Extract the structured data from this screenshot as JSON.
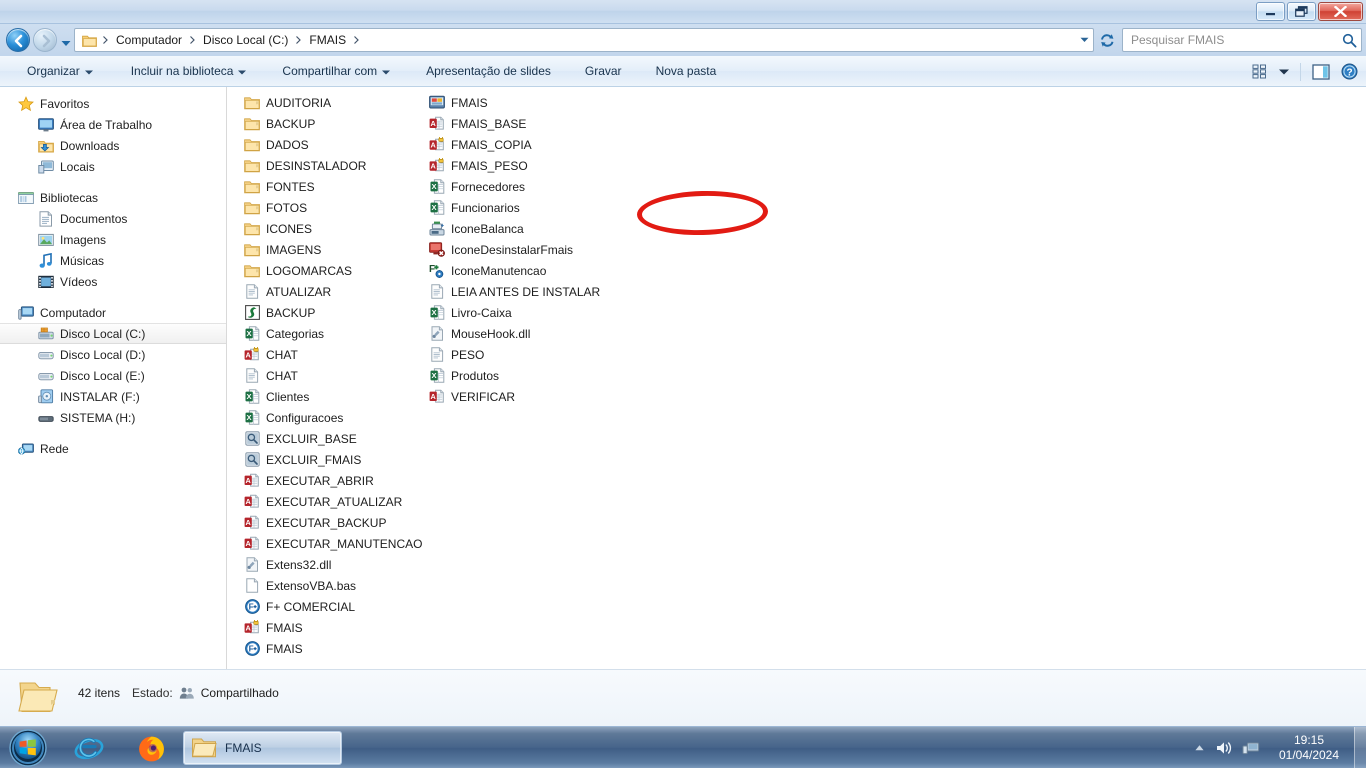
{
  "window": {
    "controls": {
      "minimize": "Minimizar",
      "maximize": "Maximizar",
      "close": "Fechar"
    }
  },
  "address": {
    "crumbs": [
      "Computador",
      "Disco Local (C:)",
      "FMAIS"
    ],
    "dropdown": "Histórico de locais",
    "refresh": "Atualizar"
  },
  "search": {
    "placeholder": "Pesquisar FMAIS",
    "value": ""
  },
  "toolbar": {
    "items": [
      {
        "label": "Organizar",
        "caret": true
      },
      {
        "label": "Incluir na biblioteca",
        "caret": true
      },
      {
        "label": "Compartilhar com",
        "caret": true
      },
      {
        "label": "Apresentação de slides",
        "caret": false
      },
      {
        "label": "Gravar",
        "caret": false
      },
      {
        "label": "Nova pasta",
        "caret": false
      }
    ],
    "view_label": "Alterar a exibição",
    "preview_label": "Mostrar o painel de visualização",
    "help_label": "Obter ajuda"
  },
  "sidebar": {
    "groups": [
      {
        "header": {
          "label": "Favoritos",
          "icon": "star-icon"
        },
        "items": [
          {
            "label": "Área de Trabalho",
            "icon": "desktop-icon"
          },
          {
            "label": "Downloads",
            "icon": "downloads-icon"
          },
          {
            "label": "Locais",
            "icon": "places-icon"
          }
        ]
      },
      {
        "header": {
          "label": "Bibliotecas",
          "icon": "libraries-icon"
        },
        "items": [
          {
            "label": "Documentos",
            "icon": "documents-icon"
          },
          {
            "label": "Imagens",
            "icon": "pictures-icon"
          },
          {
            "label": "Músicas",
            "icon": "music-icon"
          },
          {
            "label": "Vídeos",
            "icon": "videos-icon"
          }
        ]
      },
      {
        "header": {
          "label": "Computador",
          "icon": "computer-icon"
        },
        "items": [
          {
            "label": "Disco Local (C:)",
            "icon": "system-drive-icon",
            "selected": true
          },
          {
            "label": "Disco Local (D:)",
            "icon": "drive-icon"
          },
          {
            "label": "Disco Local (E:)",
            "icon": "drive-icon"
          },
          {
            "label": "INSTALAR (F:)",
            "icon": "cd-drive-icon"
          },
          {
            "label": "SISTEMA (H:)",
            "icon": "usb-drive-icon"
          }
        ]
      },
      {
        "header": {
          "label": "Rede",
          "icon": "network-icon"
        },
        "items": []
      }
    ]
  },
  "files": {
    "columns": [
      {
        "items": [
          {
            "name": "AUDITORIA",
            "icon": "folder-icon"
          },
          {
            "name": "BACKUP",
            "icon": "folder-icon"
          },
          {
            "name": "DADOS",
            "icon": "folder-icon"
          },
          {
            "name": "DESINSTALADOR",
            "icon": "folder-icon"
          },
          {
            "name": "FONTES",
            "icon": "folder-icon"
          },
          {
            "name": "FOTOS",
            "icon": "folder-icon"
          },
          {
            "name": "ICONES",
            "icon": "folder-icon"
          },
          {
            "name": "IMAGENS",
            "icon": "folder-icon"
          },
          {
            "name": "LOGOMARCAS",
            "icon": "folder-icon"
          },
          {
            "name": "ATUALIZAR",
            "icon": "text-file-icon"
          },
          {
            "name": "BACKUP",
            "icon": "script-icon"
          },
          {
            "name": "Categorias",
            "icon": "excel-icon"
          },
          {
            "name": "CHAT",
            "icon": "access-locked-icon"
          },
          {
            "name": "CHAT",
            "icon": "text-file-icon"
          },
          {
            "name": "Clientes",
            "icon": "excel-icon"
          },
          {
            "name": "Configuracoes",
            "icon": "excel-icon"
          },
          {
            "name": "EXCLUIR_BASE",
            "icon": "batch-icon"
          },
          {
            "name": "EXCLUIR_FMAIS",
            "icon": "batch-icon"
          },
          {
            "name": "EXECUTAR_ABRIR",
            "icon": "access-shortcut-icon"
          },
          {
            "name": "EXECUTAR_ATUALIZAR",
            "icon": "access-shortcut-icon"
          },
          {
            "name": "EXECUTAR_BACKUP",
            "icon": "access-shortcut-icon"
          },
          {
            "name": "EXECUTAR_MANUTENCAO",
            "icon": "access-shortcut-icon"
          },
          {
            "name": "Extens32.dll",
            "icon": "dll-icon"
          },
          {
            "name": "ExtensoVBA.bas",
            "icon": "blank-file-icon"
          },
          {
            "name": "F+ COMERCIAL",
            "icon": "fplus-icon"
          },
          {
            "name": "FMAIS",
            "icon": "access-locked-icon"
          },
          {
            "name": "FMAIS",
            "icon": "fplus-icon"
          }
        ]
      },
      {
        "items": [
          {
            "name": "FMAIS",
            "icon": "app-icon"
          },
          {
            "name": "FMAIS_BASE",
            "icon": "access-shortcut-icon",
            "annotated": true
          },
          {
            "name": "FMAIS_COPIA",
            "icon": "access-locked-icon"
          },
          {
            "name": "FMAIS_PESO",
            "icon": "access-locked-icon"
          },
          {
            "name": "Fornecedores",
            "icon": "excel-icon"
          },
          {
            "name": "Funcionarios",
            "icon": "excel-icon"
          },
          {
            "name": "IconeBalanca",
            "icon": "balance-icon"
          },
          {
            "name": "IconeDesinstalarFmais",
            "icon": "uninstall-icon"
          },
          {
            "name": "IconeManutencao",
            "icon": "maintenance-icon"
          },
          {
            "name": "LEIA ANTES DE INSTALAR",
            "icon": "text-file-icon"
          },
          {
            "name": "Livro-Caixa",
            "icon": "excel-icon"
          },
          {
            "name": "MouseHook.dll",
            "icon": "dll-icon"
          },
          {
            "name": "PESO",
            "icon": "text-file-icon"
          },
          {
            "name": "Produtos",
            "icon": "excel-icon"
          },
          {
            "name": "VERIFICAR",
            "icon": "access-shortcut-icon"
          }
        ]
      }
    ]
  },
  "status": {
    "count": "42 itens",
    "state_label": "Estado:",
    "state_value": "Compartilhado",
    "folder_icon": "folder-large-icon",
    "shared_icon": "shared-users-icon"
  },
  "taskbar": {
    "start_label": "Iniciar",
    "quicklaunch": [
      {
        "label": "Internet Explorer",
        "icon": "ie-icon"
      },
      {
        "label": "Mozilla Firefox",
        "icon": "firefox-icon"
      }
    ],
    "buttons": [
      {
        "label": "FMAIS",
        "icon": "folder-icon",
        "active": true
      }
    ],
    "tray": {
      "show_hidden": "Mostrar ícones ocultos",
      "volume": "Volume",
      "network": "Rede",
      "time": "19:15",
      "date": "01/04/2024"
    }
  },
  "colors": {
    "annotation": "#e21b13",
    "accent": "#1f4f82",
    "folder": "#fcd77f"
  }
}
